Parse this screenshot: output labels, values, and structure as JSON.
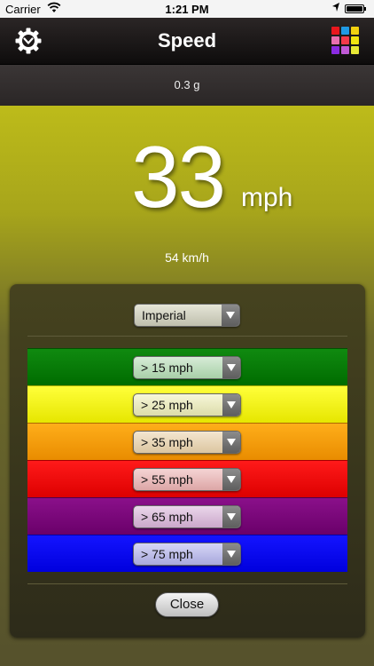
{
  "status_bar": {
    "carrier": "Carrier",
    "time": "1:21 PM"
  },
  "nav": {
    "title": "Speed",
    "left_icon": "gear-icon",
    "right_icon": "color-palette-icon"
  },
  "gforce": "0.3 g",
  "speed": {
    "value": "33",
    "unit": "mph",
    "secondary": "54 km/h"
  },
  "panel": {
    "units_select": "Imperial",
    "bands": [
      {
        "label": "> 15 mph",
        "color": "#007a00"
      },
      {
        "label": "> 25 mph",
        "color": "#f2f200"
      },
      {
        "label": "> 35 mph",
        "color": "#f39a00"
      },
      {
        "label": "> 55 mph",
        "color": "#ee0000"
      },
      {
        "label": "> 65 mph",
        "color": "#7b007b"
      },
      {
        "label": "> 75 mph",
        "color": "#0000ee"
      }
    ],
    "close_label": "Close"
  },
  "palette_colors": [
    "#e8171d",
    "#1f9ae4",
    "#f2d10f",
    "#e86fb0",
    "#8a2be2",
    "#e8e835"
  ]
}
